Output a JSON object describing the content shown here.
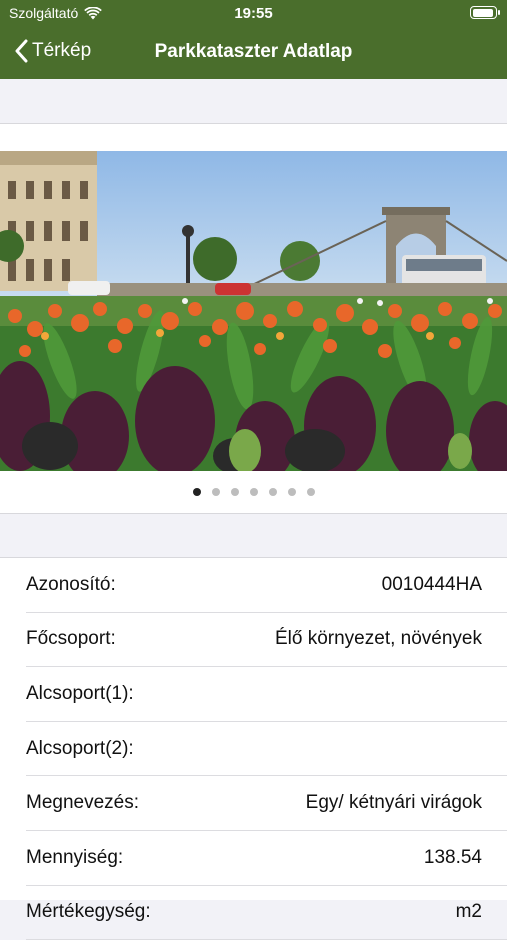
{
  "status_bar": {
    "carrier": "Szolgáltató",
    "time": "19:55"
  },
  "nav": {
    "back_label": "Térkép",
    "title": "Parkkataszter Adatlap"
  },
  "gallery": {
    "page_count": 7,
    "current_page": 1
  },
  "details": [
    {
      "label": "Azonosító:",
      "value": "0010444HA"
    },
    {
      "label": "Főcsoport:",
      "value": "Élő környezet, növények"
    },
    {
      "label": "Alcsoport(1):",
      "value": ""
    },
    {
      "label": "Alcsoport(2):",
      "value": ""
    },
    {
      "label": "Megnevezés:",
      "value": "Egy/ kétnyári virágok"
    },
    {
      "label": "Mennyiség:",
      "value": "138.54"
    },
    {
      "label": "Mértékegység:",
      "value": "m2"
    }
  ],
  "colors": {
    "header": "#4a6e2c",
    "sky": "#a9c9ec",
    "flower_orange": "#e8672a",
    "foliage": "#3c7a2e",
    "dark_foliage": "#4a1e36"
  }
}
